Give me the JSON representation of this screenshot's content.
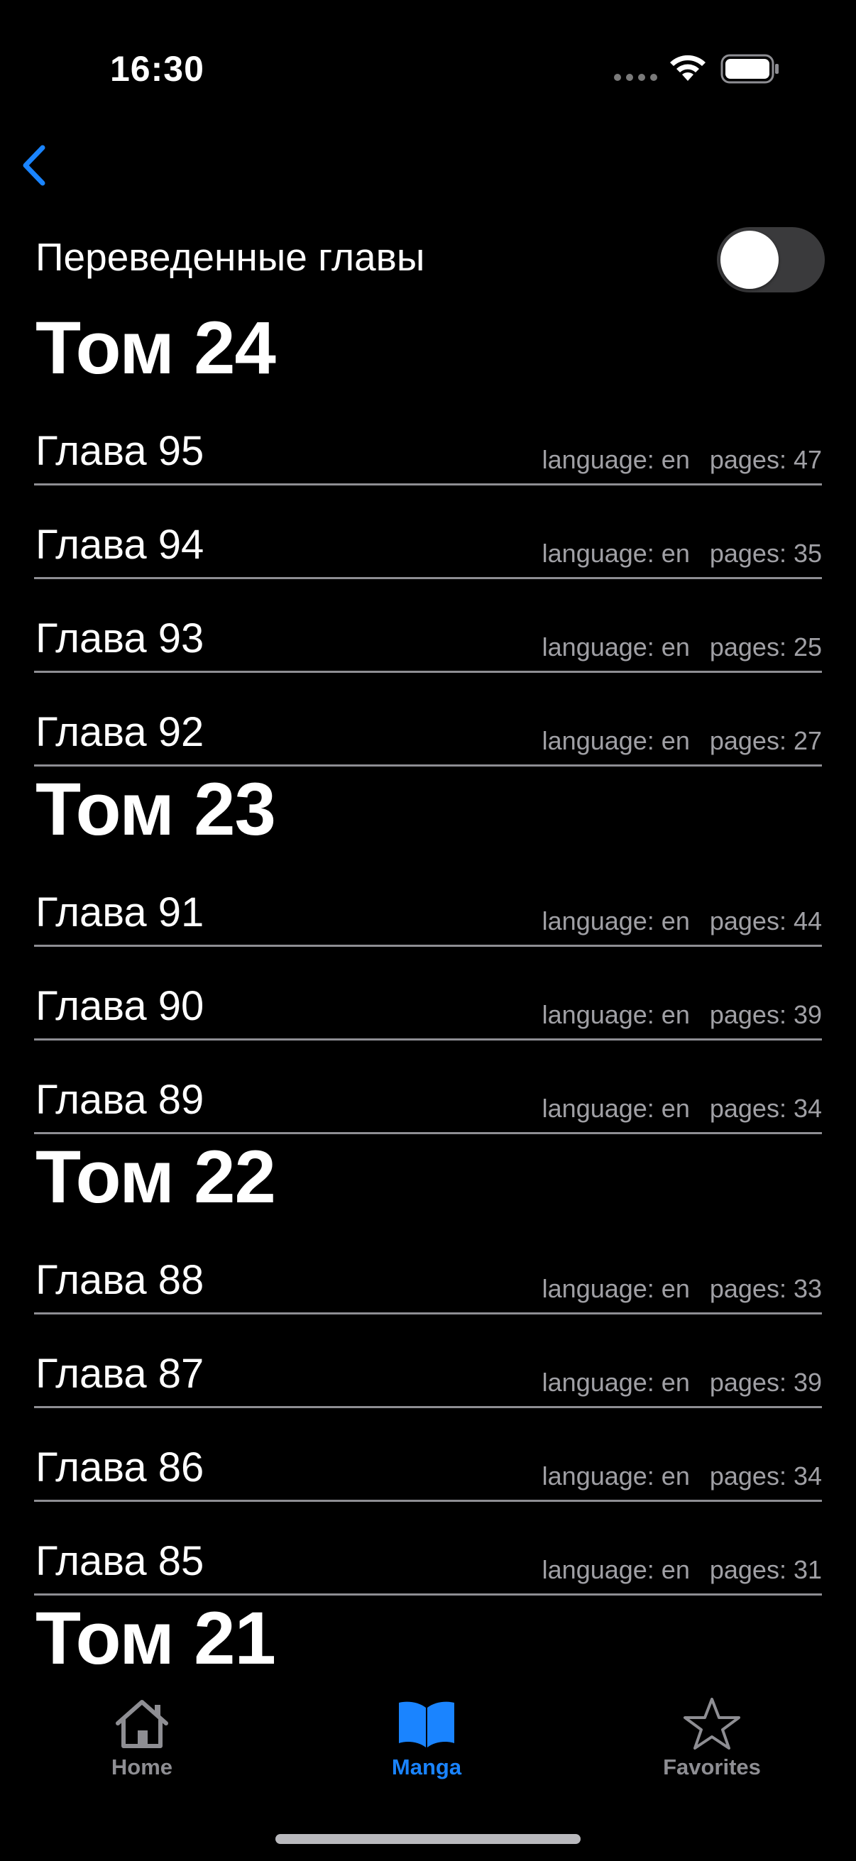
{
  "status_bar": {
    "time": "16:30"
  },
  "toggle": {
    "label": "Переведенные главы",
    "on": false
  },
  "volumes": [
    {
      "title": "Том 24",
      "chapters": [
        {
          "title": "Глава 95",
          "language": "language: en",
          "pages": "pages: 47"
        },
        {
          "title": "Глава 94",
          "language": "language: en",
          "pages": "pages: 35"
        },
        {
          "title": "Глава 93",
          "language": "language: en",
          "pages": "pages: 25"
        },
        {
          "title": "Глава 92",
          "language": "language: en",
          "pages": "pages: 27"
        }
      ]
    },
    {
      "title": "Том 23",
      "chapters": [
        {
          "title": "Глава 91",
          "language": "language: en",
          "pages": "pages: 44"
        },
        {
          "title": "Глава 90",
          "language": "language: en",
          "pages": "pages: 39"
        },
        {
          "title": "Глава 89",
          "language": "language: en",
          "pages": "pages: 34"
        }
      ]
    },
    {
      "title": "Том 22",
      "chapters": [
        {
          "title": "Глава 88",
          "language": "language: en",
          "pages": "pages: 33"
        },
        {
          "title": "Глава 87",
          "language": "language: en",
          "pages": "pages: 39"
        },
        {
          "title": "Глава 86",
          "language": "language: en",
          "pages": "pages: 34"
        },
        {
          "title": "Глава 85",
          "language": "language: en",
          "pages": "pages: 31"
        }
      ]
    },
    {
      "title": "Том 21",
      "chapters": []
    }
  ],
  "tabbar": {
    "home": "Home",
    "manga": "Manga",
    "favorites": "Favorites",
    "active": "manga"
  },
  "colors": {
    "accent": "#1a84ff",
    "inactive": "#8e8e93"
  }
}
